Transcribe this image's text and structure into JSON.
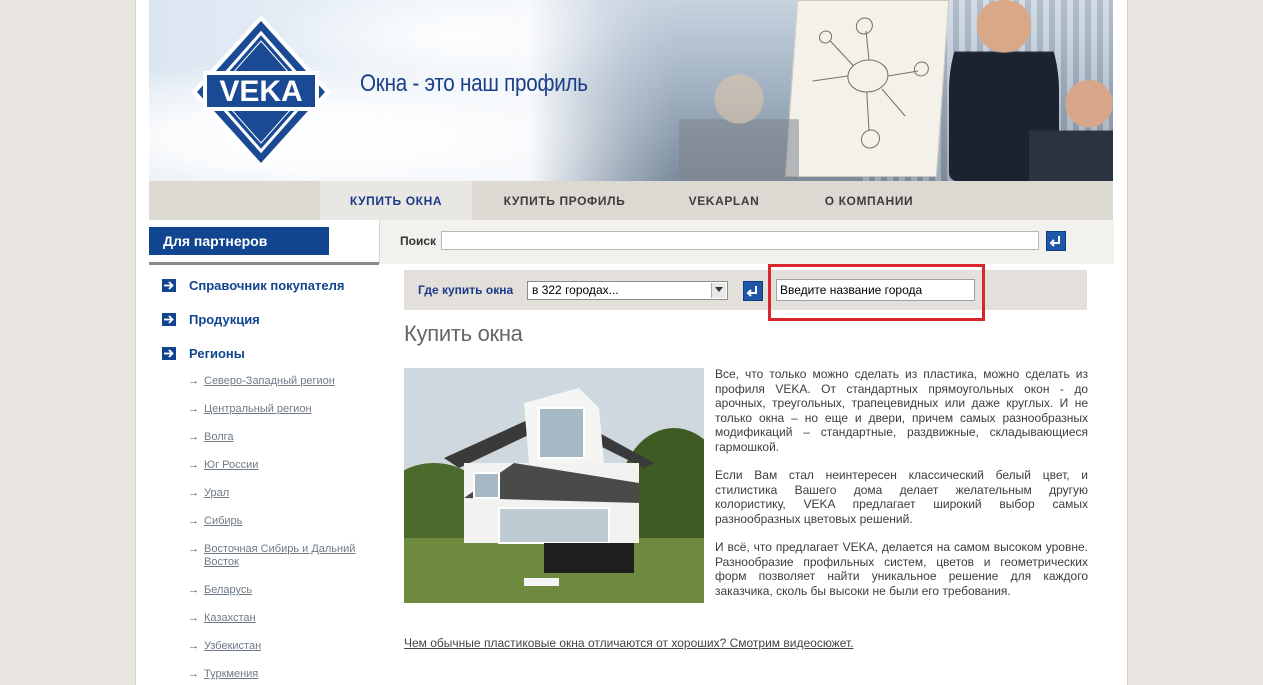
{
  "brand": {
    "logo_text": "VEKA",
    "slogan": "Окна - это наш профиль"
  },
  "nav": {
    "items": [
      {
        "label": "КУПИТЬ ОКНА",
        "active": true
      },
      {
        "label": "КУПИТЬ ПРОФИЛЬ",
        "active": false
      },
      {
        "label": "VEKAPLAN",
        "active": false
      },
      {
        "label": "О КОМПАНИИ",
        "active": false
      }
    ]
  },
  "partners": {
    "label": "Для партнеров"
  },
  "search": {
    "label": "Поиск",
    "value": "",
    "placeholder": ""
  },
  "sidebar": {
    "main_items": [
      {
        "label": "Справочник покупателя"
      },
      {
        "label": "Продукция"
      },
      {
        "label": "Регионы"
      }
    ],
    "regions": [
      "Северо-Западный регион",
      "Центральный регион",
      "Волга",
      "Юг России",
      "Урал",
      "Сибирь",
      "Восточная Сибирь и Дальний Восток",
      "Беларусь",
      "Казахстан",
      "Узбекистан",
      "Туркмения"
    ]
  },
  "where_to_buy": {
    "label": "Где купить окна",
    "select_value": "в 322 городах...",
    "city_input_value": "Введите название города"
  },
  "main": {
    "title": "Купить окна",
    "paragraphs": [
      "Все, что только можно сделать из пластика, можно сделать из профиля VEKA. От стандартных прямоугольных окон - до арочных, треугольных, трапецевидных или даже круглых. И не только окна – но еще и двери, причем самых разнообразных модификаций – стандартные, раздвижные, складывающиеся гармошкой.",
      "Если Вам стал неинтересен классический белый цвет, и стилистика Вашего дома делает желательным другую колористику, VEKA предлагает широкий выбор самых разнообразных цветовых решений.",
      "И всё, что предлагает VEKA, делается на самом высоком уровне. Разнообразие профильных систем, цветов и геометрических форм позволяет найти уникальное решение для каждого заказчика, сколь бы высоки не были его требования."
    ],
    "video_link": "Чем  обычные пластиковые окна отличаются от хороших? Смотрим видеосюжет."
  },
  "colors": {
    "brand_blue": "#12458f",
    "highlight_red": "#d8262c"
  }
}
